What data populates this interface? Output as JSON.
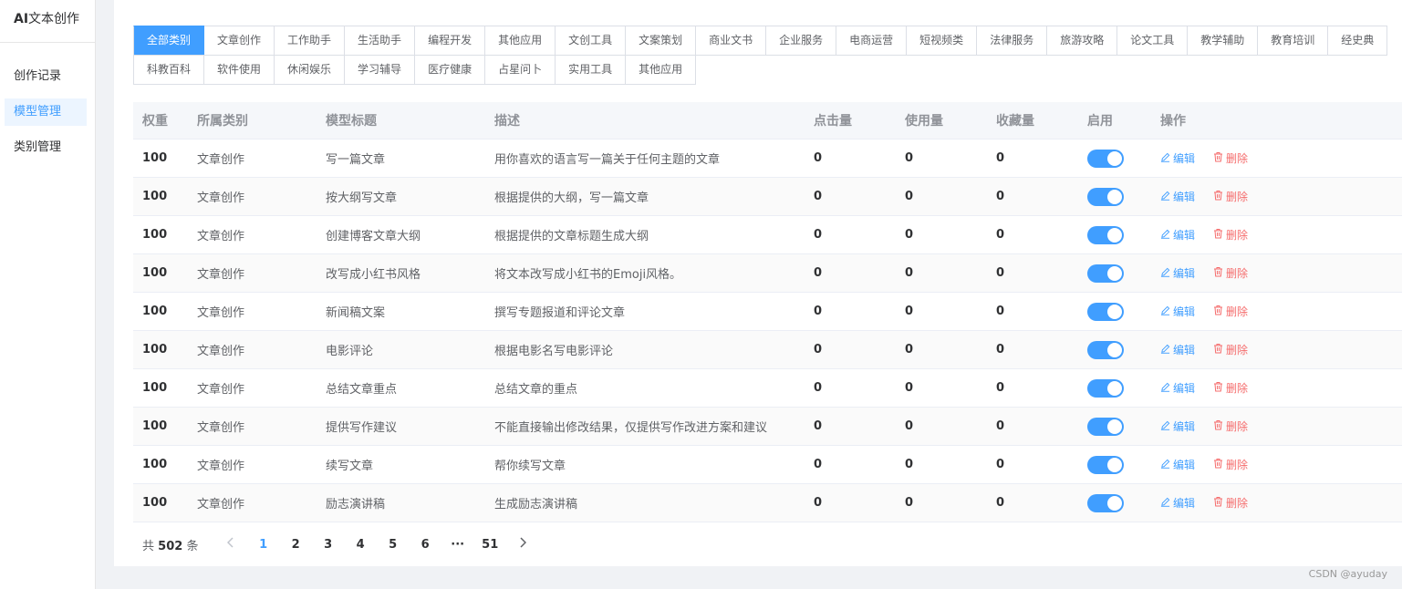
{
  "sidebar": {
    "brand_ai": "AI",
    "brand_rest": "文本创作",
    "items": [
      {
        "label": "创作记录"
      },
      {
        "label": "模型管理"
      },
      {
        "label": "类别管理"
      }
    ]
  },
  "tabs": {
    "row1": [
      "全部类别",
      "文章创作",
      "工作助手",
      "生活助手",
      "编程开发",
      "其他应用",
      "文创工具",
      "文案策划",
      "商业文书",
      "企业服务",
      "电商运营",
      "短视频类",
      "法律服务",
      "旅游攻略",
      "论文工具",
      "教学辅助",
      "教育培训",
      "经史典"
    ],
    "row2": [
      "科教百科",
      "软件使用",
      "休闲娱乐",
      "学习辅导",
      "医疗健康",
      "占星问卜",
      "实用工具",
      "其他应用"
    ],
    "active": "全部类别"
  },
  "table": {
    "headers": {
      "weight": "权重",
      "category": "所属类别",
      "title": "模型标题",
      "desc": "描述",
      "clicks": "点击量",
      "uses": "使用量",
      "favs": "收藏量",
      "enabled": "启用",
      "ops": "操作"
    },
    "edit_label": "编辑",
    "delete_label": "删除",
    "rows": [
      {
        "weight": "100",
        "category": "文章创作",
        "title": "写一篇文章",
        "desc": "用你喜欢的语言写一篇关于任何主题的文章",
        "clicks": "0",
        "uses": "0",
        "favs": "0",
        "enabled": true
      },
      {
        "weight": "100",
        "category": "文章创作",
        "title": "按大纲写文章",
        "desc": "根据提供的大纲，写一篇文章",
        "clicks": "0",
        "uses": "0",
        "favs": "0",
        "enabled": true
      },
      {
        "weight": "100",
        "category": "文章创作",
        "title": "创建博客文章大纲",
        "desc": "根据提供的文章标题生成大纲",
        "clicks": "0",
        "uses": "0",
        "favs": "0",
        "enabled": true
      },
      {
        "weight": "100",
        "category": "文章创作",
        "title": "改写成小红书风格",
        "desc": "将文本改写成小红书的Emoji风格。",
        "clicks": "0",
        "uses": "0",
        "favs": "0",
        "enabled": true
      },
      {
        "weight": "100",
        "category": "文章创作",
        "title": "新闻稿文案",
        "desc": "撰写专题报道和评论文章",
        "clicks": "0",
        "uses": "0",
        "favs": "0",
        "enabled": true
      },
      {
        "weight": "100",
        "category": "文章创作",
        "title": "电影评论",
        "desc": "根据电影名写电影评论",
        "clicks": "0",
        "uses": "0",
        "favs": "0",
        "enabled": true
      },
      {
        "weight": "100",
        "category": "文章创作",
        "title": "总结文章重点",
        "desc": "总结文章的重点",
        "clicks": "0",
        "uses": "0",
        "favs": "0",
        "enabled": true
      },
      {
        "weight": "100",
        "category": "文章创作",
        "title": "提供写作建议",
        "desc": "不能直接输出修改结果，仅提供写作改进方案和建议",
        "clicks": "0",
        "uses": "0",
        "favs": "0",
        "enabled": true
      },
      {
        "weight": "100",
        "category": "文章创作",
        "title": "续写文章",
        "desc": "帮你续写文章",
        "clicks": "0",
        "uses": "0",
        "favs": "0",
        "enabled": true
      },
      {
        "weight": "100",
        "category": "文章创作",
        "title": "励志演讲稿",
        "desc": "生成励志演讲稿",
        "clicks": "0",
        "uses": "0",
        "favs": "0",
        "enabled": true
      }
    ]
  },
  "pagination": {
    "total_prefix": "共",
    "total": "502",
    "total_suffix": "条",
    "pages": [
      "1",
      "2",
      "3",
      "4",
      "5",
      "6",
      "···",
      "51"
    ],
    "current": "1",
    "prev_icon": "chevron-left-icon",
    "next_icon": "chevron-right-icon"
  },
  "watermark": "CSDN @ayuday",
  "colors": {
    "accent": "#409eff",
    "danger": "#f56c6c",
    "header_bg": "#f5f7fa",
    "page_bg": "#f0f2f5"
  }
}
